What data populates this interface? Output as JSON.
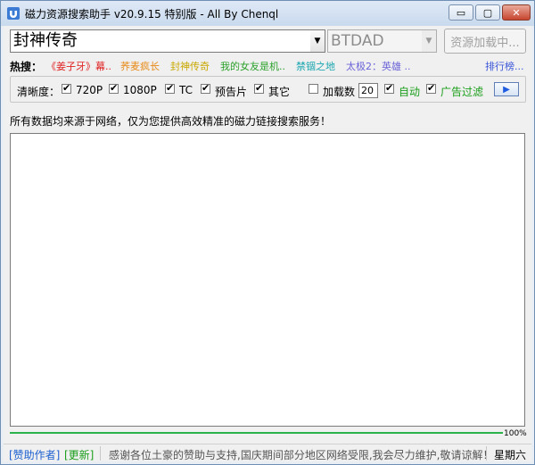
{
  "window": {
    "title": "磁力资源搜索助手 v20.9.15 特别版 - All By Chenql"
  },
  "controls": {
    "minimize": "▭",
    "maximize": "▢",
    "close": "✕"
  },
  "search": {
    "keyword": "封神传奇",
    "site": "BTDAD",
    "load_button": "资源加载中...",
    "dropdown_glyph": "▼"
  },
  "hot": {
    "label": "热搜：",
    "items": [
      {
        "text": "《姜子牙》幕..",
        "color": "#e02020"
      },
      {
        "text": "荞麦疯长",
        "color": "#e88a18"
      },
      {
        "text": "封神传奇",
        "color": "#c9a800"
      },
      {
        "text": "我的女友是机..",
        "color": "#2aa12a"
      },
      {
        "text": "禁锢之地",
        "color": "#1aa6b0"
      },
      {
        "text": "太极2：英雄 ..",
        "color": "#6a63d8"
      }
    ],
    "rank_link": "排行榜..."
  },
  "options": {
    "clarity_label": "清晰度：",
    "q720": "720P",
    "q1080": "1080P",
    "tc": "TC",
    "trailer": "预告片",
    "other": "其它",
    "load_count_label": "加载数",
    "load_count": "20",
    "auto": "自动",
    "ad_filter": "广告过滤",
    "check_mark": "✔",
    "go_glyph": "▶"
  },
  "notice": "所有数据均来源于网络，仅为您提供高效精准的磁力链接搜索服务！",
  "progress": {
    "value": 1.0,
    "label": "100%"
  },
  "status": {
    "support": "[赞助作者]",
    "update": "[更新]",
    "message": "感谢各位土豪的赞助与支持,国庆期间部分地区网络受限,我会尽力维护,敬请谅解！",
    "weekday": "星期六"
  }
}
